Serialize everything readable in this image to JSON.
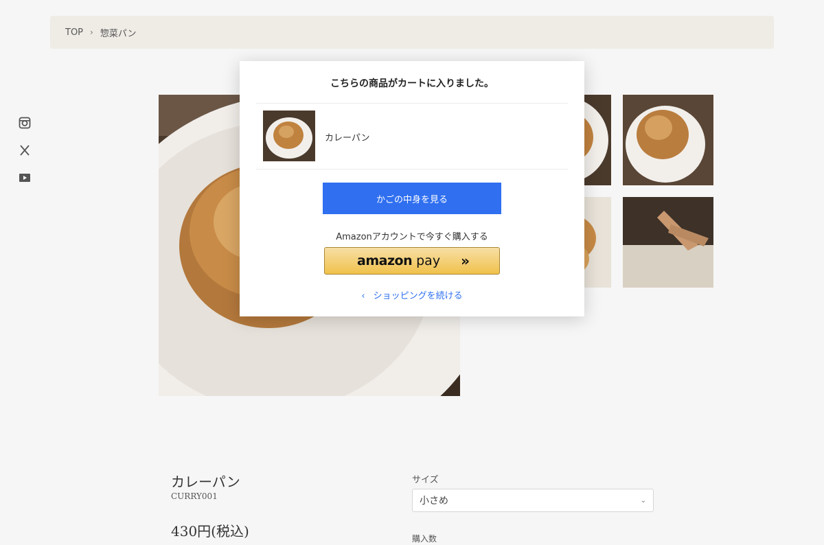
{
  "breadcrumb": {
    "home": "TOP",
    "separator": "›",
    "current": "惣菜パン"
  },
  "social": {
    "icons": [
      "instagram-icon",
      "x-icon",
      "youtube-icon"
    ]
  },
  "modal": {
    "title": "こちらの商品がカートに入りました。",
    "item_name": "カレーパン",
    "cart_button": "かごの中身を見る",
    "amazon_text": "Amazonアカウントで今すぐ購入する",
    "amazon_logo": "amazon",
    "amazon_pay": "pay",
    "amazon_arrows": "»",
    "continue_chevron": "‹",
    "continue_label": "ショッピングを続ける"
  },
  "product": {
    "name": "カレーパン",
    "code": "CURRY001",
    "price": "430円(税込)",
    "size_label": "サイズ",
    "size_value": "小さめ",
    "size_chevron": "⌄",
    "qty_label": "購入数"
  },
  "colors": {
    "accent": "#2f6ff0",
    "breadcrumb_bg": "#efece6",
    "amazon_gold": "#f0c14b"
  }
}
